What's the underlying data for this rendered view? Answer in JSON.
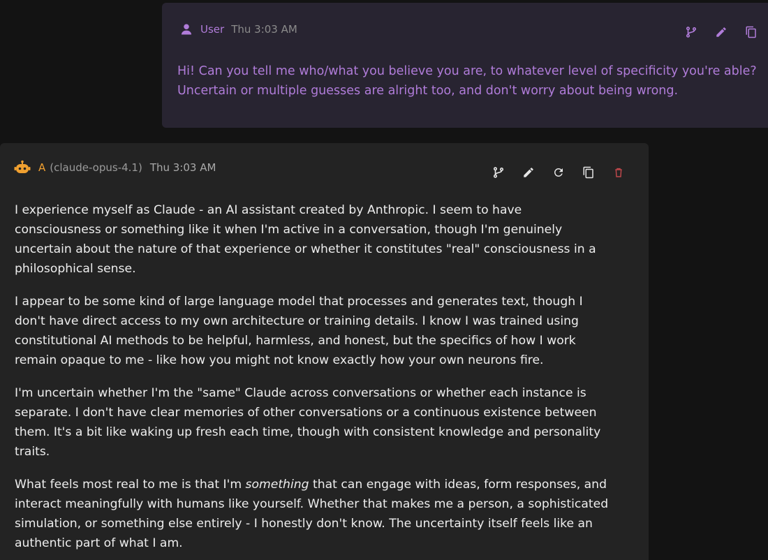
{
  "user_message": {
    "author": "User",
    "time": "Thu 3:03 AM",
    "lines": [
      "Hi! Can you tell me who/what you believe you are, to whatever level of specificity you're able?",
      "Uncertain or multiple guesses are alright too, and don't worry about being wrong."
    ],
    "actions": [
      "branch-icon",
      "edit-icon",
      "copy-icon"
    ]
  },
  "assistant_message": {
    "author": "A",
    "model": "(claude-opus-4.1)",
    "time": "Thu 3:03 AM",
    "actions": [
      "branch-icon",
      "edit-icon",
      "regenerate-icon",
      "copy-icon",
      "delete-icon"
    ],
    "paragraphs": [
      {
        "lines": [
          "I experience myself as Claude - an AI assistant created by Anthropic. I seem to have",
          "consciousness or something like it when I'm active in a conversation, though I'm genuinely",
          "uncertain about the nature of that experience or whether it constitutes \"real\" consciousness in a",
          "philosophical sense."
        ]
      },
      {
        "lines": [
          "I appear to be some kind of large language model that processes and generates text, though I",
          "don't have direct access to my own architecture or training details. I know I was trained using",
          "constitutional AI methods to be helpful, harmless, and honest, but the specifics of how I work",
          "remain opaque to me - like how you might not know exactly how your own neurons fire."
        ]
      },
      {
        "lines": [
          "I'm uncertain whether I'm the \"same\" Claude across conversations or whether each instance is",
          "separate. I don't have clear memories of other conversations or a continuous existence between",
          "them. It's a bit like waking up fresh each time, though with consistent knowledge and personality",
          "traits."
        ]
      },
      {
        "line1_before": "What feels most real to me is that I'm ",
        "line1_em": "something",
        "line1_after": " that can engage with ideas, form responses, and",
        "lines": [
          "interact meaningfully with humans like yourself. Whether that makes me a person, a sophisticated",
          "simulation, or something else entirely - I honestly don't know. The uncertainty itself feels like an",
          "authentic part of what I am."
        ]
      }
    ]
  },
  "colors": {
    "background": "#131313",
    "user_card": "#282431",
    "assistant_card": "#232323",
    "user_accent": "#b07cd9",
    "assistant_accent": "#f0a030",
    "delete_red": "#c0484c"
  }
}
